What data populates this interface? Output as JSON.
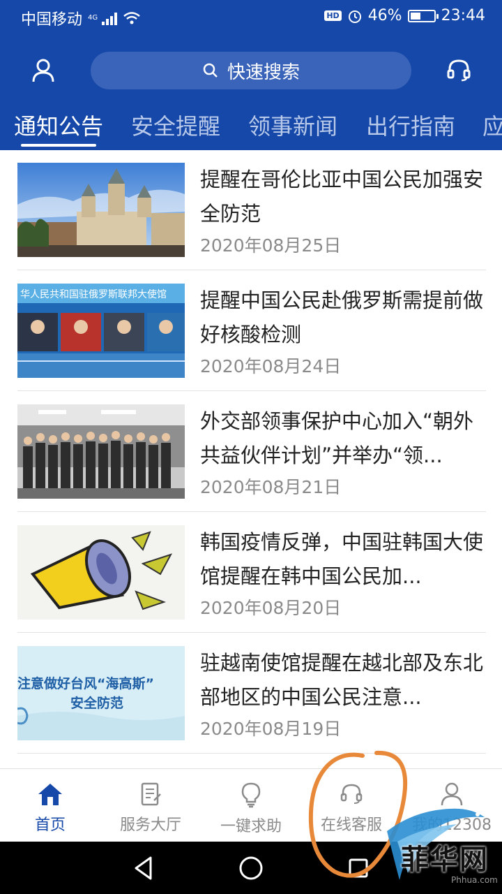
{
  "status_bar": {
    "carrier": "中国移动",
    "network": "4G",
    "hd_badge": "HD",
    "battery": "46%",
    "battery_level": 0.46,
    "time": "23:44"
  },
  "header": {
    "search_label": "快速搜索",
    "left_icon": "user-icon",
    "right_icon": "headset-icon"
  },
  "tabs": [
    "通知公告",
    "安全提醒",
    "领事新闻",
    "出行指南",
    "应"
  ],
  "active_tab": 0,
  "news": [
    {
      "title": "提醒在哥伦比亚中国公民加强安全防范",
      "date": "2020年08月25日"
    },
    {
      "title": "提醒中国公民赴俄罗斯需提前做好核酸检测",
      "date": "2020年08月24日"
    },
    {
      "title": "外交部领事保护中心加入“朝外共益伙伴计划”并举办“领...",
      "date": "2020年08月21日"
    },
    {
      "title": "韩国疫情反弹，中国驻韩国大使馆提醒在韩中国公民加...",
      "date": "2020年08月20日"
    },
    {
      "title": "驻越南使馆提醒在越北部及东北部地区的中国公民注意...",
      "date": "2020年08月19日"
    }
  ],
  "thumbnails": {
    "thumb2_caption": "华人民共和国驻俄罗斯联邦大使馆",
    "thumb5_line1": "注意做好台风“海高斯”",
    "thumb5_line2": "安全防范"
  },
  "bottom_nav": [
    {
      "label": "首页",
      "icon": "home-icon",
      "active": true
    },
    {
      "label": "服务大厅",
      "icon": "document-icon",
      "active": false
    },
    {
      "label": "一键求助",
      "icon": "lightbulb-icon",
      "active": false
    },
    {
      "label": "在线客服",
      "icon": "headset-icon",
      "active": false
    },
    {
      "label": "我的12308",
      "icon": "person-icon",
      "active": false
    }
  ],
  "watermark": {
    "text": "菲华网",
    "url": "Phhua.com"
  },
  "colors": {
    "primary": "#1548a8",
    "search_bg": "#3a64b9",
    "annotation": "#e8893a"
  }
}
